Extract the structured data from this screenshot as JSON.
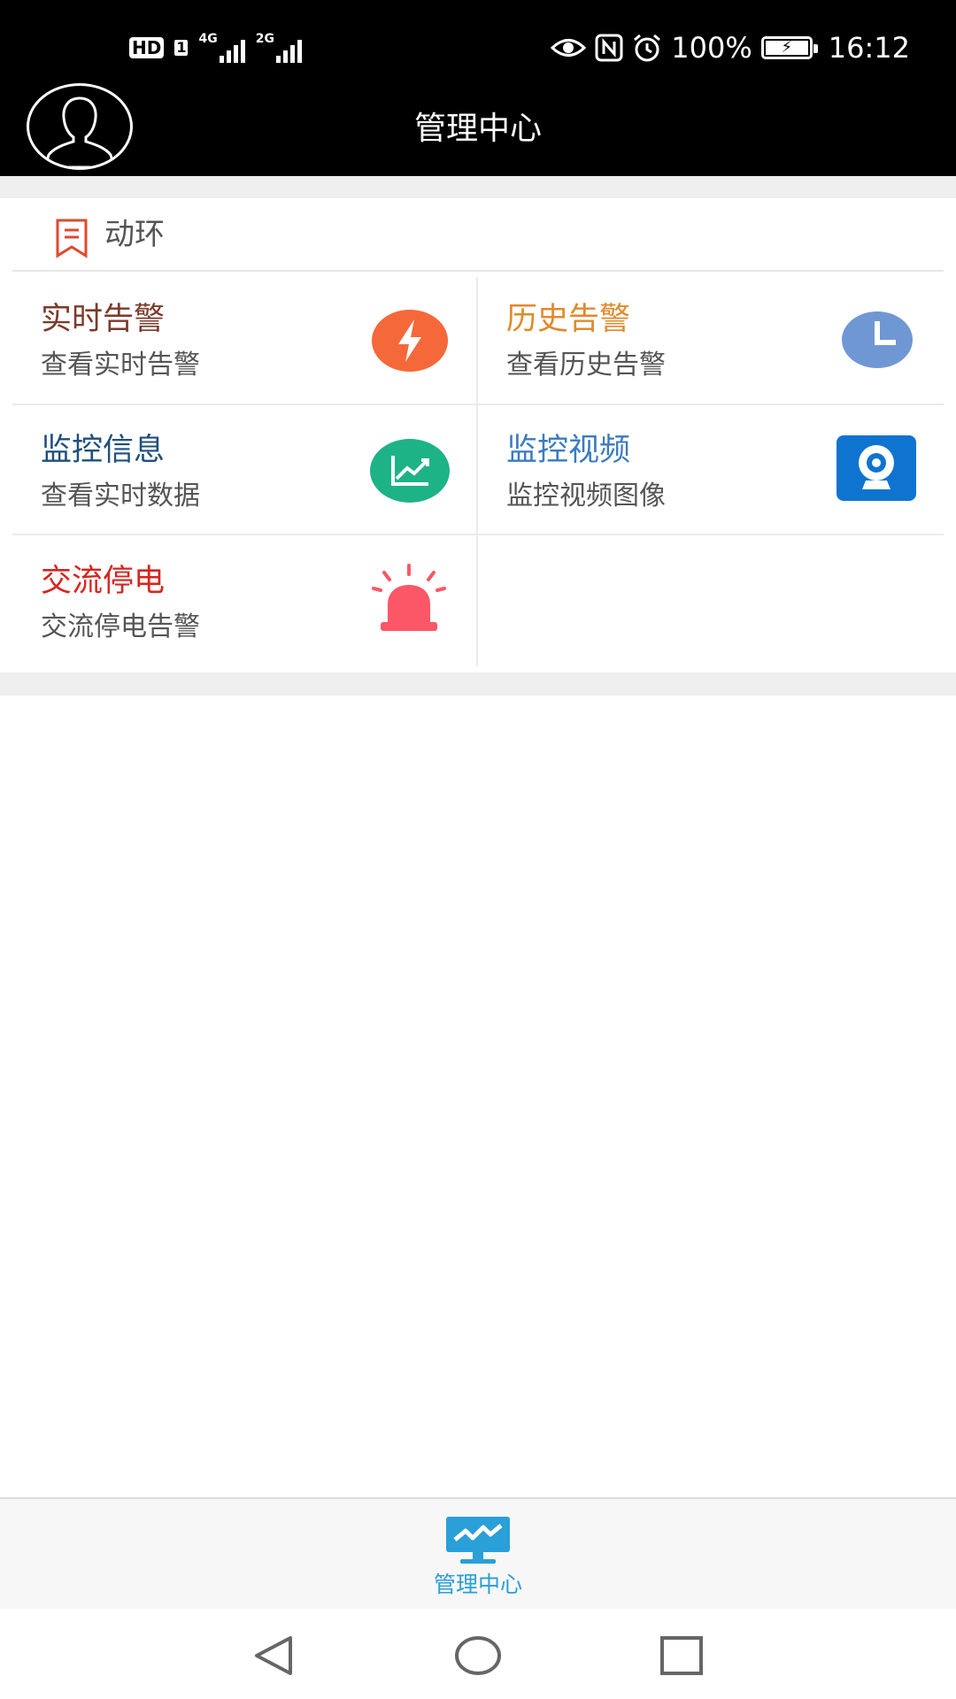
{
  "status_bar": {
    "hd": "HD",
    "sim": "1",
    "net1": "4G",
    "net2": "2G",
    "battery": "100%",
    "time": "16:12"
  },
  "header": {
    "title": "管理中心"
  },
  "section": {
    "title": "动环"
  },
  "tiles": [
    {
      "title": "实时告警",
      "subtitle": "查看实时告警",
      "title_color": "#7a3b2a",
      "icon": "lightning-icon",
      "icon_color": "#f5683a"
    },
    {
      "title": "历史告警",
      "subtitle": "查看历史告警",
      "title_color": "#e08a2c",
      "icon": "clock-icon",
      "icon_color": "#6f97d3"
    },
    {
      "title": "监控信息",
      "subtitle": "查看实时数据",
      "title_color": "#1f4f7a",
      "icon": "trend-chart-icon",
      "icon_color": "#1db386"
    },
    {
      "title": "监控视频",
      "subtitle": "监控视频图像",
      "title_color": "#3a7bbf",
      "icon": "camera-icon",
      "icon_color": "#0f74cf"
    },
    {
      "title": "交流停电",
      "subtitle": "交流停电告警",
      "title_color": "#d8241f",
      "icon": "alarm-siren-icon",
      "icon_color": "#fb5766"
    }
  ],
  "bottom_nav": {
    "label": "管理中心",
    "color": "#2a9fd8"
  }
}
